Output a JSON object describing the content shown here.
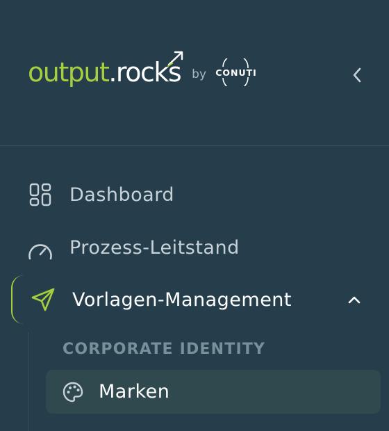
{
  "brand": {
    "name_part1": "output",
    "name_part2": ".rocks",
    "by": "by",
    "partner": "CONUTI",
    "accent_color": "#a6cf3f"
  },
  "header": {
    "collapse_icon": "chevron-left-icon"
  },
  "nav": {
    "items": [
      {
        "label": "Dashboard",
        "icon": "grid-icon"
      },
      {
        "label": "Prozess-Leitstand",
        "icon": "gauge-icon"
      },
      {
        "label": "Vorlagen-Management",
        "icon": "send-icon",
        "active": true,
        "expanded": true
      }
    ],
    "section_title": "CORPORATE IDENTITY",
    "subitems": [
      {
        "label": "Marken",
        "icon": "palette-icon",
        "selected": true
      }
    ]
  },
  "colors": {
    "background": "#263e4b",
    "selected_background": "#30494f",
    "muted_text": "#76909c"
  }
}
